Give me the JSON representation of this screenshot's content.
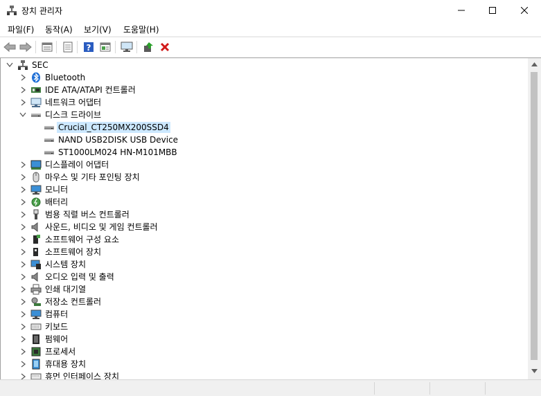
{
  "window": {
    "title": "장치 관리자"
  },
  "menu": [
    "파일(F)",
    "동작(A)",
    "보기(V)",
    "도움말(H)"
  ],
  "toolbar": {
    "buttons": [
      "back-icon",
      "forward-icon",
      "properties-icon",
      "show-hidden-icon",
      "help-icon",
      "view-icon",
      "monitor-icon",
      "update-driver-icon",
      "uninstall-icon"
    ]
  },
  "tree": {
    "root": "SEC",
    "items": [
      {
        "label": "Bluetooth",
        "icon": "bluetooth-icon",
        "expanded": false
      },
      {
        "label": "IDE ATA/ATAPI 컨트롤러",
        "icon": "ide-controller-icon",
        "expanded": false
      },
      {
        "label": "네트워크 어댑터",
        "icon": "network-adapter-icon",
        "expanded": false
      },
      {
        "label": "디스크 드라이브",
        "icon": "disk-drive-icon",
        "expanded": true,
        "children": [
          {
            "label": "Crucial_CT250MX200SSD4",
            "icon": "disk-drive-icon",
            "selected": true
          },
          {
            "label": "NAND USB2DISK USB Device",
            "icon": "disk-drive-icon"
          },
          {
            "label": "ST1000LM024 HN-M101MBB",
            "icon": "disk-drive-icon"
          }
        ]
      },
      {
        "label": "디스플레이 어댑터",
        "icon": "display-adapter-icon",
        "expanded": false
      },
      {
        "label": "마우스 및 기타 포인팅 장치",
        "icon": "mouse-icon",
        "expanded": false
      },
      {
        "label": "모니터",
        "icon": "monitor-icon",
        "expanded": false
      },
      {
        "label": "배터리",
        "icon": "battery-icon",
        "expanded": false
      },
      {
        "label": "범용 직렬 버스 컨트롤러",
        "icon": "usb-icon",
        "expanded": false
      },
      {
        "label": "사운드, 비디오 및 게임 컨트롤러",
        "icon": "speaker-icon",
        "expanded": false
      },
      {
        "label": "소프트웨어 구성 요소",
        "icon": "software-component-icon",
        "expanded": false
      },
      {
        "label": "소프트웨어 장치",
        "icon": "software-device-icon",
        "expanded": false
      },
      {
        "label": "시스템 장치",
        "icon": "system-device-icon",
        "expanded": false
      },
      {
        "label": "오디오 입력 및 출력",
        "icon": "audio-icon",
        "expanded": false
      },
      {
        "label": "인쇄 대기열",
        "icon": "printer-icon",
        "expanded": false
      },
      {
        "label": "저장소 컨트롤러",
        "icon": "storage-controller-icon",
        "expanded": false
      },
      {
        "label": "컴퓨터",
        "icon": "computer-icon",
        "expanded": false
      },
      {
        "label": "키보드",
        "icon": "keyboard-icon",
        "expanded": false
      },
      {
        "label": "펌웨어",
        "icon": "firmware-icon",
        "expanded": false
      },
      {
        "label": "프로세서",
        "icon": "processor-icon",
        "expanded": false
      },
      {
        "label": "휴대용 장치",
        "icon": "portable-device-icon",
        "expanded": false
      },
      {
        "label": "휴먼 인터페이스 장치",
        "icon": "hid-icon",
        "expanded": false
      }
    ]
  },
  "colors": {
    "selection": "#cce8ff",
    "uninstall": "#d11a1a",
    "help_blue": "#2a5cc0"
  }
}
